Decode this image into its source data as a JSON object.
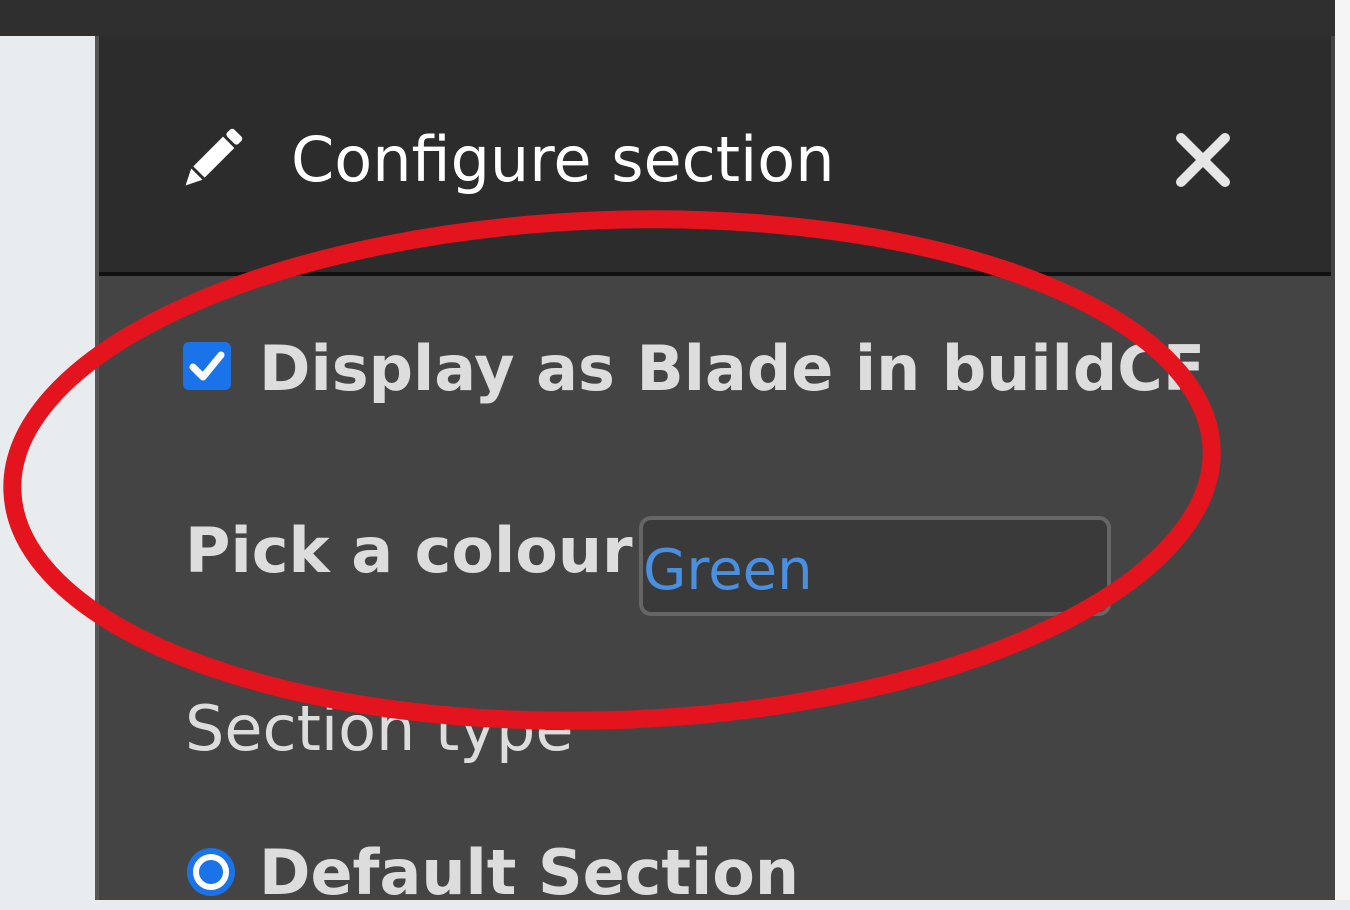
{
  "panel": {
    "title": "Configure section",
    "title_icon": "pencil-icon",
    "close_icon": "close-icon"
  },
  "form": {
    "blade_checkbox": {
      "label": "Display as Blade in buildCF",
      "checked": true
    },
    "colour": {
      "label": "Pick a colour",
      "value": "Green"
    },
    "section_type": {
      "label": "Section type",
      "options": [
        {
          "label": "Default Section",
          "selected": true
        }
      ]
    }
  },
  "annotation": {
    "shape": "ellipse",
    "color": "#e3141e"
  },
  "colors": {
    "accent": "#1a73e8",
    "panel_bg": "#444444",
    "header_bg": "#2c2c2c",
    "input_text": "#4a8fe0"
  }
}
